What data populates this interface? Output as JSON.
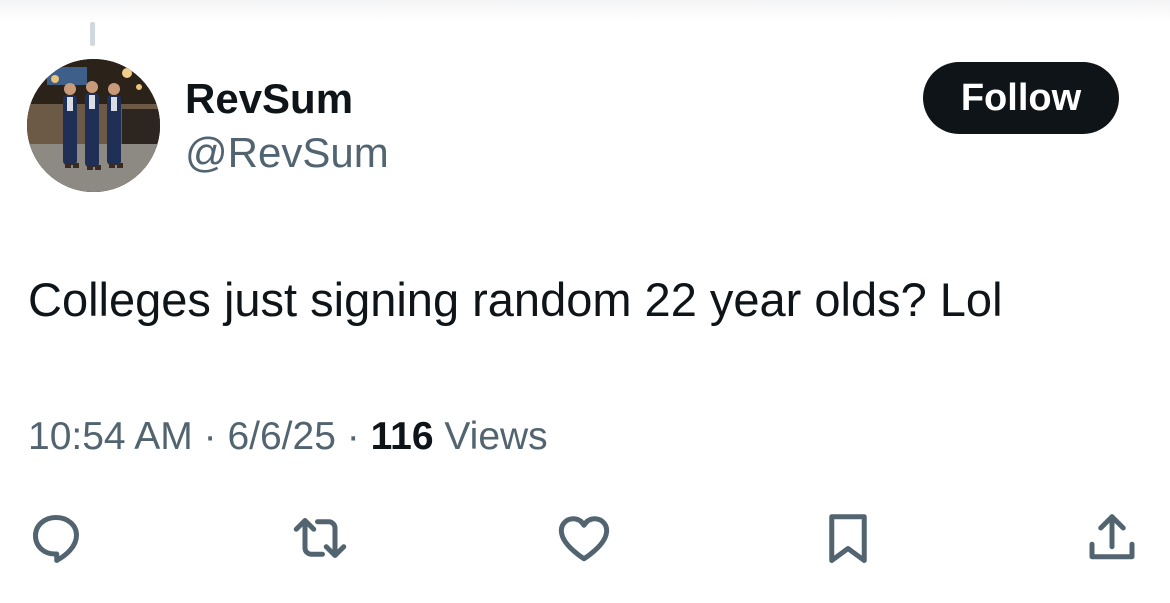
{
  "author": {
    "display_name": "RevSum",
    "handle": "@RevSum",
    "avatar_icon": "profile-photo"
  },
  "follow_label": "Follow",
  "tweet": {
    "text": "Colleges just signing random 22 year olds? Lol",
    "time": "10:54 AM",
    "date": "6/6/25",
    "separator": "·",
    "views_count": "116",
    "views_label": "Views"
  },
  "actions": [
    {
      "icon": "reply-icon"
    },
    {
      "icon": "retweet-icon"
    },
    {
      "icon": "like-icon"
    },
    {
      "icon": "bookmark-icon"
    },
    {
      "icon": "share-icon"
    }
  ],
  "colors": {
    "text_primary": "#0f1419",
    "text_secondary": "#536471",
    "button_bg": "#0f1419",
    "button_text": "#ffffff"
  }
}
